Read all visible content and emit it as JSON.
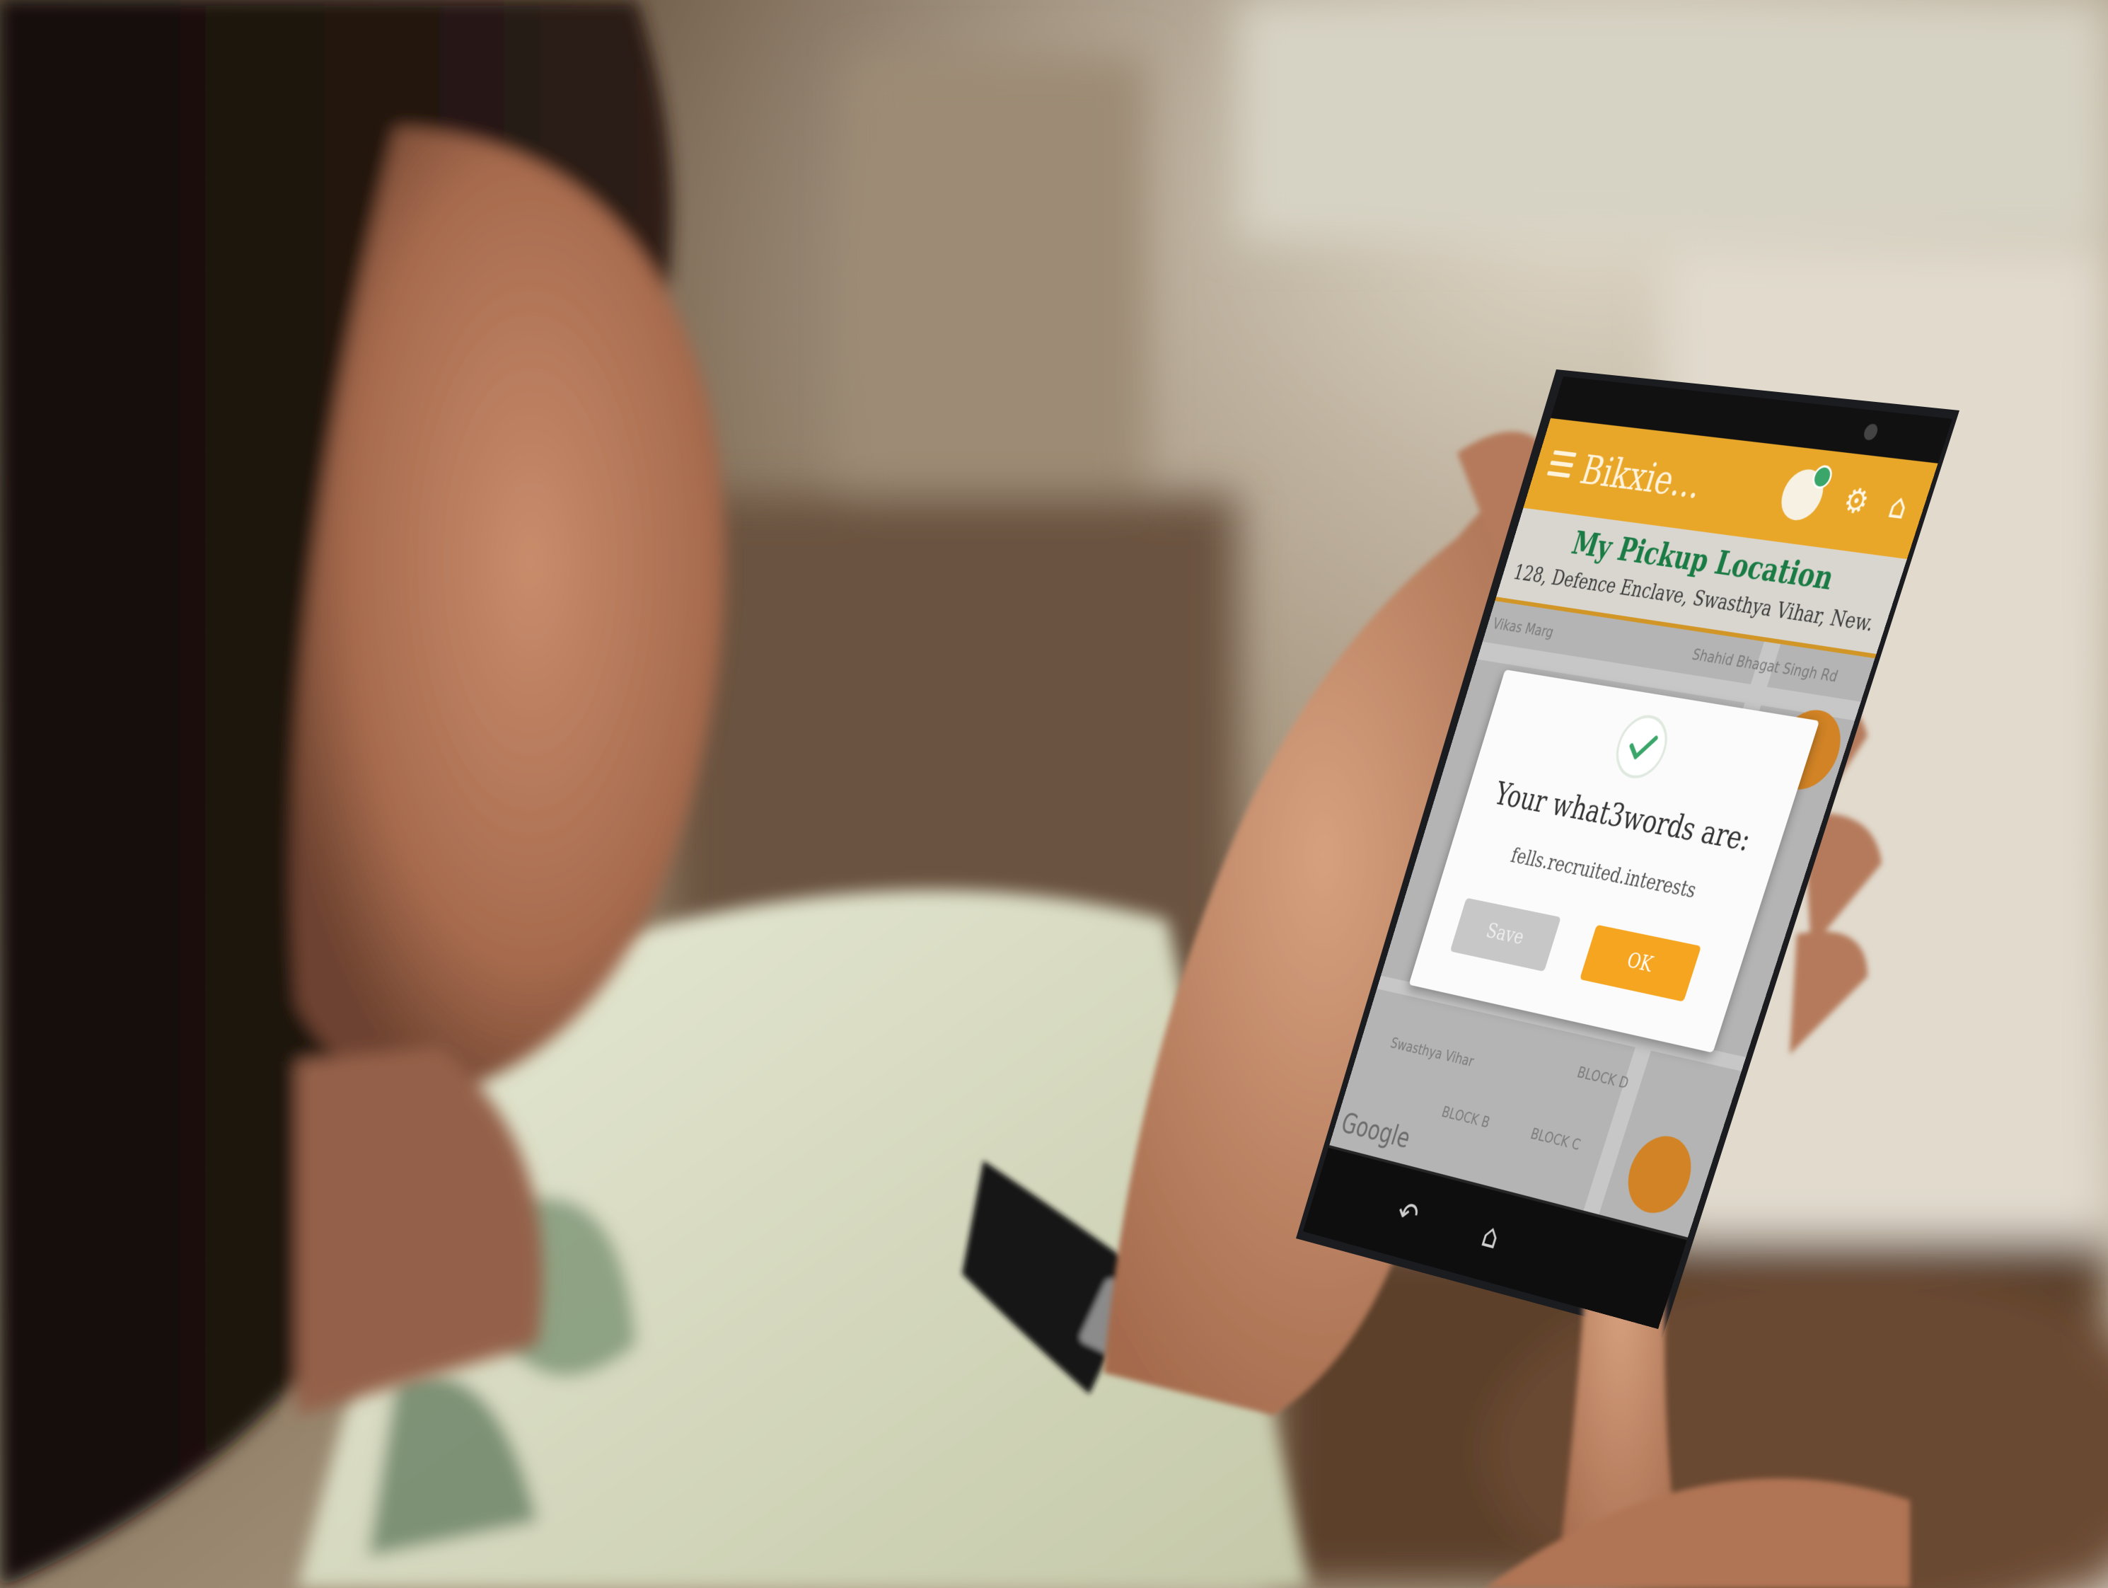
{
  "app": {
    "title": "Bikxie",
    "title_display": "Bikxie...",
    "accent_color": "#e9a72a",
    "header_icons": [
      "menu-icon",
      "user-avatar-icon",
      "bike-icon",
      "cart-icon"
    ]
  },
  "pickup": {
    "title": "My Pickup Location",
    "address": "128, Defence Enclave, Swasthya Vihar, New..."
  },
  "map": {
    "road_labels": [
      "Vikas Marg",
      "Shahid Bhagat Singh Rd",
      "Swasthya Vihar",
      "BLOCK B",
      "BLOCK C",
      "BLOCK D"
    ],
    "attribution": "Google"
  },
  "dialog": {
    "heading": "Your what3words are:",
    "words": "fells.recruited.interests",
    "save_label": "Save",
    "ok_label": "OK",
    "icon": "check-icon"
  },
  "nav": {
    "icons": [
      "back-icon",
      "home-icon"
    ]
  }
}
